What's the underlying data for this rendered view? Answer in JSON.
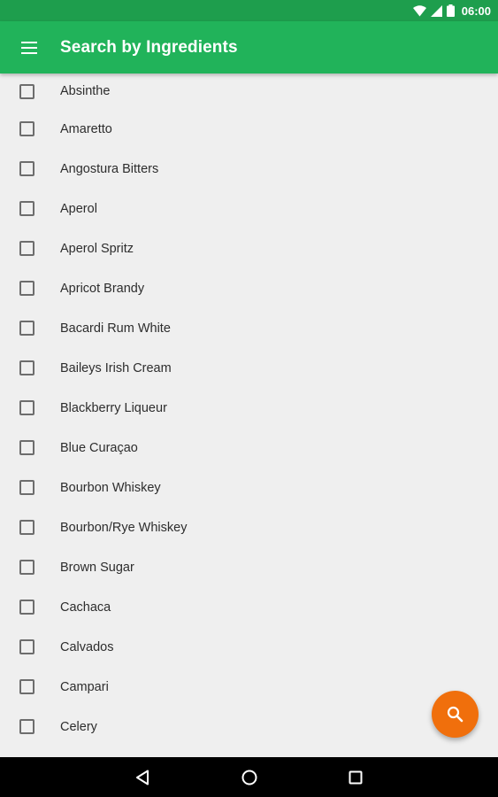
{
  "status_bar": {
    "time": "06:00",
    "icons": [
      "wifi-icon",
      "signal-icon",
      "battery-icon"
    ]
  },
  "app_bar": {
    "title": "Search by Ingredients",
    "menu_icon": "hamburger-menu-icon",
    "color": "#21b35a"
  },
  "ingredients": [
    "Absinthe",
    "Amaretto",
    "Angostura Bitters",
    "Aperol",
    "Aperol Spritz",
    "Apricot Brandy",
    "Bacardi Rum White",
    "Baileys Irish Cream",
    "Blackberry Liqueur",
    "Blue Curaçao",
    "Bourbon Whiskey",
    "Bourbon/Rye Whiskey",
    "Brown Sugar",
    "Cachaca",
    "Calvados",
    "Campari",
    "Celery"
  ],
  "fab": {
    "icon": "search-icon",
    "color": "#f06f0c"
  },
  "nav_bar": {
    "icons": [
      "back-icon",
      "home-icon",
      "recents-icon"
    ]
  }
}
